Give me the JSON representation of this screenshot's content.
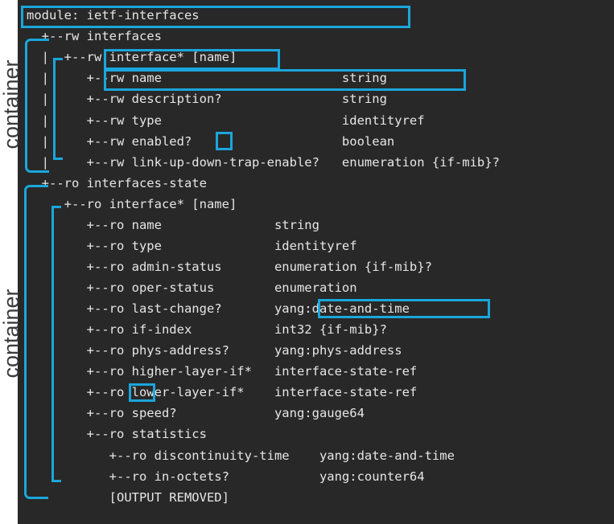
{
  "diagram": {
    "labels": {
      "container_top": "container",
      "container_bottom": "container"
    },
    "lines": [
      "module: ietf-interfaces",
      "  +--rw interfaces",
      "  |  +--rw interface* [name]",
      "  |     +--rw name                        string",
      "  |     +--rw description?                string",
      "  |     +--rw type                        identityref",
      "  |     +--rw enabled?                    boolean",
      "  |     +--rw link-up-down-trap-enable?   enumeration {if-mib}?",
      "  +--ro interfaces-state",
      "     +--ro interface* [name]",
      "        +--ro name               string",
      "        +--ro type               identityref",
      "        +--ro admin-status       enumeration {if-mib}?",
      "        +--ro oper-status        enumeration",
      "        +--ro last-change?       yang:date-and-time",
      "        +--ro if-index           int32 {if-mib}?",
      "        +--ro phys-address?      yang:phys-address",
      "        +--ro higher-layer-if*   interface-state-ref",
      "        +--ro lower-layer-if*    interface-state-ref",
      "        +--ro speed?             yang:gauge64",
      "        +--ro statistics",
      "           +--ro discontinuity-time    yang:date-and-time",
      "           +--ro in-octets?            yang:counter64",
      "           [OUTPUT REMOVED]"
    ]
  }
}
